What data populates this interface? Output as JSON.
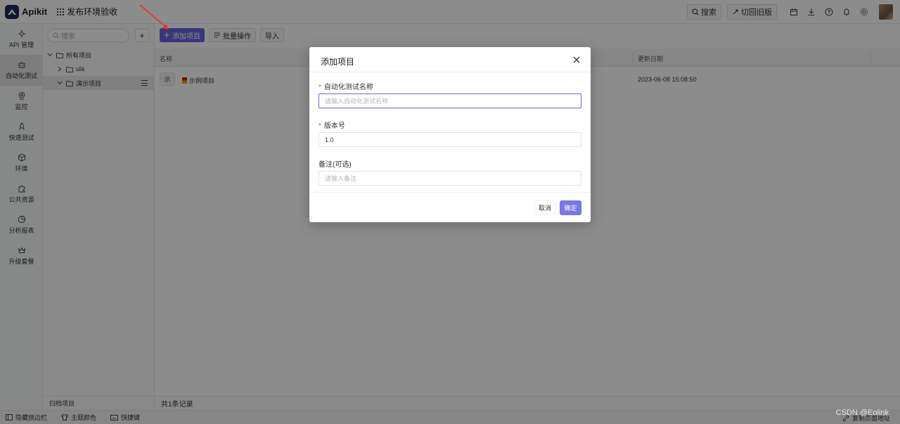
{
  "app": {
    "name": "Apikit",
    "workspace": "发布环境验收"
  },
  "topbar": {
    "search_label": "搜索",
    "old_version_label": "切回旧版"
  },
  "leftnav": {
    "items": [
      {
        "label": "API 管理",
        "icon": "api-icon"
      },
      {
        "label": "自动化测试",
        "icon": "robot-icon",
        "active": true
      },
      {
        "label": "监控",
        "icon": "monitor-icon"
      },
      {
        "label": "快速测试",
        "icon": "rocket-icon"
      },
      {
        "label": "环境",
        "icon": "cube-icon"
      },
      {
        "label": "公共资源",
        "icon": "puzzle-icon"
      },
      {
        "label": "分析报表",
        "icon": "pie-icon"
      },
      {
        "label": "升级套餐",
        "icon": "crown-icon"
      }
    ]
  },
  "tree": {
    "search_placeholder": "搜索",
    "add_label": "+",
    "items": [
      {
        "label": "所有项目"
      },
      {
        "label": "ula"
      },
      {
        "label": "演示项目"
      }
    ],
    "archive_label": "归档项目"
  },
  "toolbar": {
    "add_label": "添加项目",
    "batch_label": "批量操作",
    "import_label": "导入"
  },
  "table": {
    "col_name": "名称",
    "col_updated": "更新日期",
    "rows": [
      {
        "tag": "示",
        "name": "示例项目",
        "updated": "2023-06-08 15:08:50"
      }
    ],
    "count_label": "共1条记录"
  },
  "statusbar": {
    "hide_sidebar": "隐藏侧边栏",
    "theme_color": "主题颜色",
    "shortcuts": "快捷键",
    "copy_url": "复制页面地址"
  },
  "modal": {
    "title": "添加项目",
    "fields": {
      "name": {
        "label": "自动化测试名称",
        "placeholder": "请输入自动化测试名称",
        "value": ""
      },
      "version": {
        "label": "版本号",
        "value": "1.0"
      },
      "note": {
        "label": "备注(可选)",
        "placeholder": "请输入备注",
        "value": ""
      }
    },
    "cancel_label": "取消",
    "ok_label": "确定"
  },
  "watermark": "CSDN @Eolink",
  "colors": {
    "primary": "#6a63e0",
    "required": "#e34d4d",
    "annotation_arrow": "#e8332a"
  }
}
